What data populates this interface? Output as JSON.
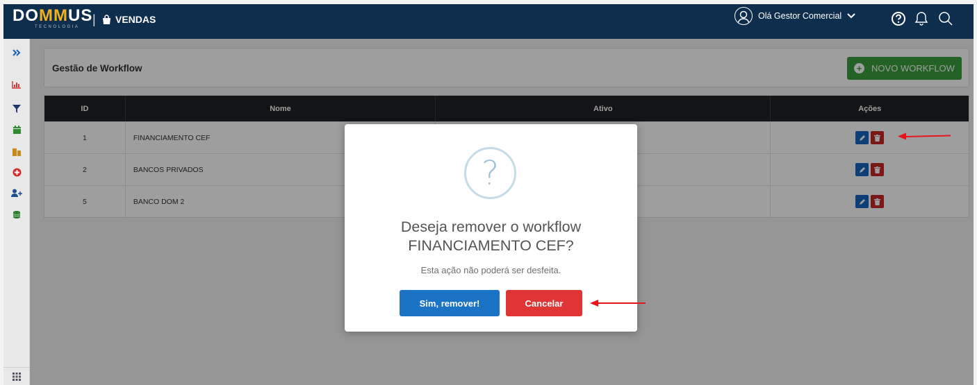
{
  "header": {
    "logo_main": "DO",
    "logo_accent": "MM",
    "logo_end": "US",
    "logo_sub": "TECNOLOGIA",
    "separator": "|",
    "module": "VENDAS",
    "user_greeting": "Olá Gestor Comercial",
    "icons": [
      "user-avatar-icon",
      "chevron-down-icon",
      "help-icon",
      "bell-icon",
      "search-icon"
    ]
  },
  "sidebar": {
    "items": [
      "expand-icon",
      "chart-icon",
      "filter-icon",
      "calendar-icon",
      "building-icon",
      "plus-circle-icon",
      "add-user-icon",
      "money-stack-icon"
    ],
    "bottom": "grid-icon"
  },
  "panel": {
    "title": "Gestão de Workflow",
    "new_button": "NOVO WORKFLOW"
  },
  "table": {
    "headers": [
      "ID",
      "Nome",
      "Ativo",
      "Ações"
    ],
    "rows": [
      {
        "id": "1",
        "nome": "FINANCIAMENTO CEF"
      },
      {
        "id": "2",
        "nome": "BANCOS PRIVADOS"
      },
      {
        "id": "5",
        "nome": "BANCO DOM 2"
      }
    ]
  },
  "modal": {
    "icon": "?",
    "title_line1": "Deseja remover o workflow",
    "title_line2": "FINANCIAMENTO CEF?",
    "text": "Esta ação não poderá ser desfeita.",
    "confirm": "Sim, remover!",
    "cancel": "Cancelar"
  },
  "colors": {
    "header_bg": "#0f2d4c",
    "accent_logo": "#f0b21a",
    "green": "#3a9d3d",
    "edit_blue": "#1565c0",
    "delete_red": "#c62828",
    "confirm_blue": "#1a73c4",
    "cancel_red": "#e03535",
    "annotation_arrow": "#e8141b"
  }
}
